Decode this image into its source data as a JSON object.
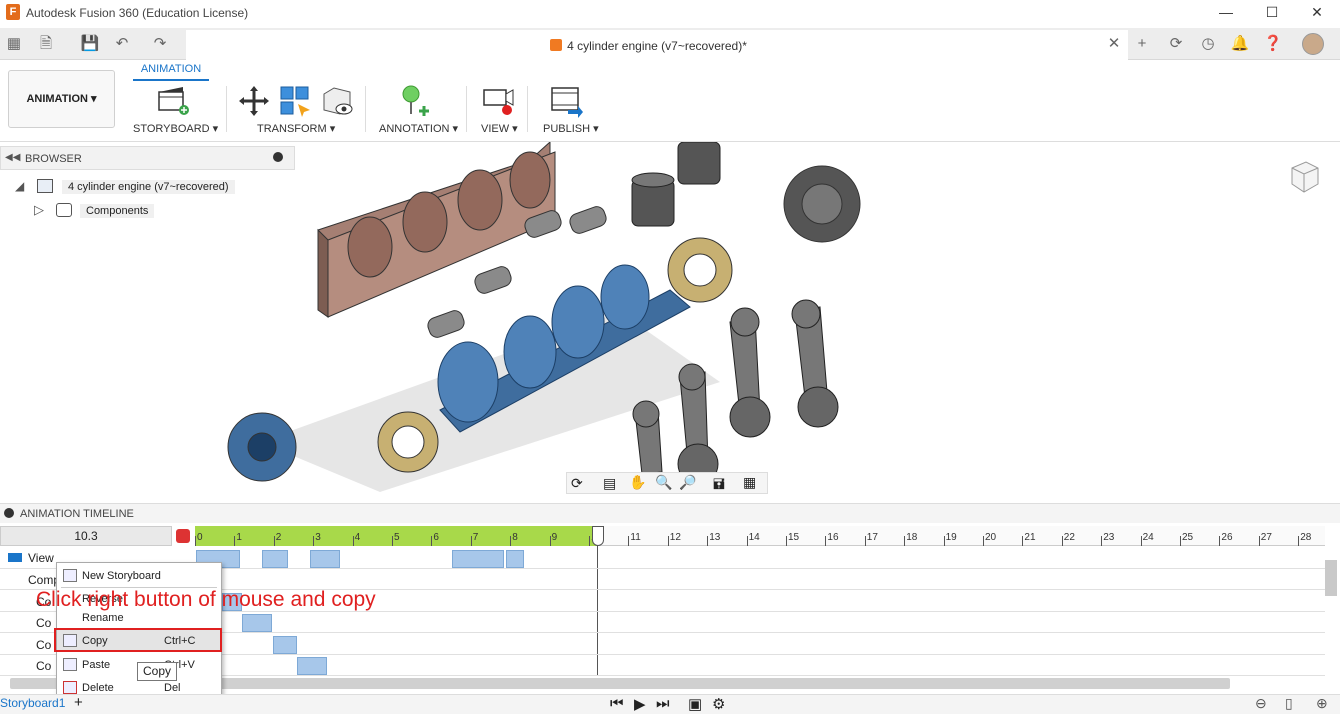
{
  "window": {
    "title": "Autodesk Fusion 360 (Education License)"
  },
  "document": {
    "tab_title": "4 cylinder engine (v7~recovered)*"
  },
  "ribbon": {
    "workspace": "ANIMATION",
    "active_tab": "ANIMATION",
    "groups": [
      "STORYBOARD",
      "TRANSFORM",
      "ANNOTATION",
      "VIEW",
      "PUBLISH"
    ]
  },
  "browser": {
    "title": "BROWSER",
    "root": "4 cylinder engine (v7~recovered)",
    "child": "Components"
  },
  "timeline": {
    "title": "ANIMATION TIMELINE",
    "current_time": "10.3",
    "ticks": [
      "0",
      "1",
      "2",
      "3",
      "4",
      "5",
      "6",
      "7",
      "8",
      "9",
      "10",
      "11",
      "12",
      "13",
      "14",
      "15",
      "16",
      "17",
      "18",
      "19",
      "20",
      "21",
      "22",
      "23",
      "24",
      "25",
      "26",
      "27",
      "28"
    ],
    "tracks": [
      "View",
      "Comp",
      "Co",
      "Co",
      "Co",
      "Co"
    ]
  },
  "context_menu": {
    "items": [
      {
        "label": "New Storyboard",
        "shortcut": ""
      },
      {
        "label": "Reverse",
        "shortcut": ""
      },
      {
        "label": "Rename",
        "shortcut": ""
      },
      {
        "label": "Copy",
        "shortcut": "Ctrl+C"
      },
      {
        "label": "Paste",
        "shortcut": "Ctrl+V"
      },
      {
        "label": "Delete",
        "shortcut": "Del"
      }
    ]
  },
  "tooltip": "Copy",
  "annotation": "Click right button of mouse and copy",
  "bottom": {
    "storyboard_tab": "Storyboard1",
    "add_label": "+"
  },
  "colors": {
    "accent": "#1a75c9",
    "annotation": "#e02020",
    "timeline_green": "#a8d94a",
    "keyframe": "#a7c7ea"
  }
}
